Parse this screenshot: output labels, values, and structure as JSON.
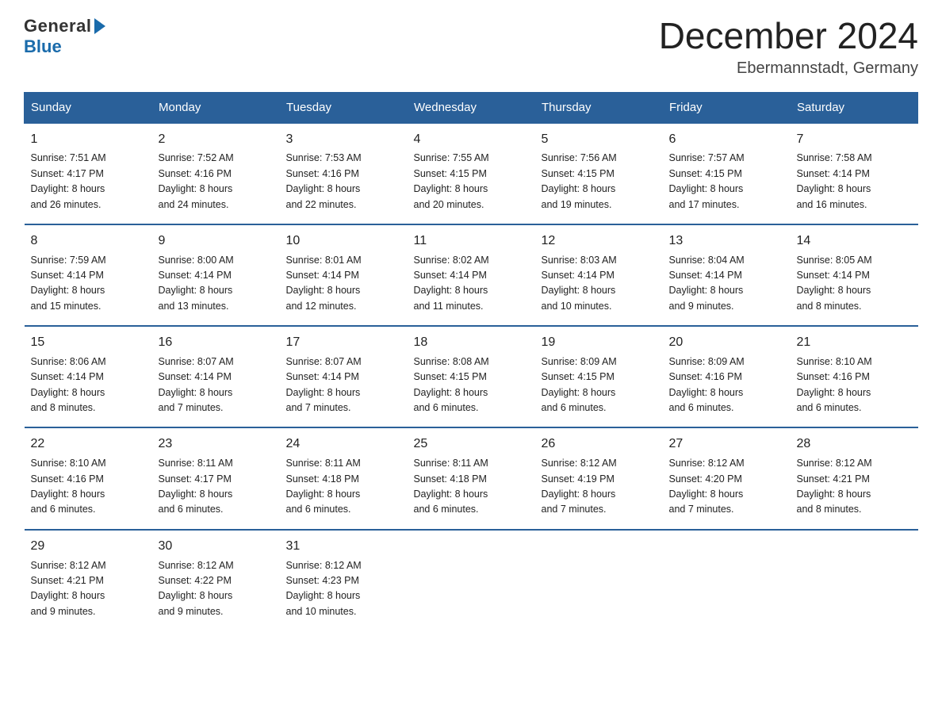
{
  "logo": {
    "general": "General",
    "blue": "Blue"
  },
  "title": {
    "month": "December 2024",
    "location": "Ebermannstadt, Germany"
  },
  "headers": [
    "Sunday",
    "Monday",
    "Tuesday",
    "Wednesday",
    "Thursday",
    "Friday",
    "Saturday"
  ],
  "weeks": [
    [
      {
        "day": "1",
        "info": "Sunrise: 7:51 AM\nSunset: 4:17 PM\nDaylight: 8 hours\nand 26 minutes."
      },
      {
        "day": "2",
        "info": "Sunrise: 7:52 AM\nSunset: 4:16 PM\nDaylight: 8 hours\nand 24 minutes."
      },
      {
        "day": "3",
        "info": "Sunrise: 7:53 AM\nSunset: 4:16 PM\nDaylight: 8 hours\nand 22 minutes."
      },
      {
        "day": "4",
        "info": "Sunrise: 7:55 AM\nSunset: 4:15 PM\nDaylight: 8 hours\nand 20 minutes."
      },
      {
        "day": "5",
        "info": "Sunrise: 7:56 AM\nSunset: 4:15 PM\nDaylight: 8 hours\nand 19 minutes."
      },
      {
        "day": "6",
        "info": "Sunrise: 7:57 AM\nSunset: 4:15 PM\nDaylight: 8 hours\nand 17 minutes."
      },
      {
        "day": "7",
        "info": "Sunrise: 7:58 AM\nSunset: 4:14 PM\nDaylight: 8 hours\nand 16 minutes."
      }
    ],
    [
      {
        "day": "8",
        "info": "Sunrise: 7:59 AM\nSunset: 4:14 PM\nDaylight: 8 hours\nand 15 minutes."
      },
      {
        "day": "9",
        "info": "Sunrise: 8:00 AM\nSunset: 4:14 PM\nDaylight: 8 hours\nand 13 minutes."
      },
      {
        "day": "10",
        "info": "Sunrise: 8:01 AM\nSunset: 4:14 PM\nDaylight: 8 hours\nand 12 minutes."
      },
      {
        "day": "11",
        "info": "Sunrise: 8:02 AM\nSunset: 4:14 PM\nDaylight: 8 hours\nand 11 minutes."
      },
      {
        "day": "12",
        "info": "Sunrise: 8:03 AM\nSunset: 4:14 PM\nDaylight: 8 hours\nand 10 minutes."
      },
      {
        "day": "13",
        "info": "Sunrise: 8:04 AM\nSunset: 4:14 PM\nDaylight: 8 hours\nand 9 minutes."
      },
      {
        "day": "14",
        "info": "Sunrise: 8:05 AM\nSunset: 4:14 PM\nDaylight: 8 hours\nand 8 minutes."
      }
    ],
    [
      {
        "day": "15",
        "info": "Sunrise: 8:06 AM\nSunset: 4:14 PM\nDaylight: 8 hours\nand 8 minutes."
      },
      {
        "day": "16",
        "info": "Sunrise: 8:07 AM\nSunset: 4:14 PM\nDaylight: 8 hours\nand 7 minutes."
      },
      {
        "day": "17",
        "info": "Sunrise: 8:07 AM\nSunset: 4:14 PM\nDaylight: 8 hours\nand 7 minutes."
      },
      {
        "day": "18",
        "info": "Sunrise: 8:08 AM\nSunset: 4:15 PM\nDaylight: 8 hours\nand 6 minutes."
      },
      {
        "day": "19",
        "info": "Sunrise: 8:09 AM\nSunset: 4:15 PM\nDaylight: 8 hours\nand 6 minutes."
      },
      {
        "day": "20",
        "info": "Sunrise: 8:09 AM\nSunset: 4:16 PM\nDaylight: 8 hours\nand 6 minutes."
      },
      {
        "day": "21",
        "info": "Sunrise: 8:10 AM\nSunset: 4:16 PM\nDaylight: 8 hours\nand 6 minutes."
      }
    ],
    [
      {
        "day": "22",
        "info": "Sunrise: 8:10 AM\nSunset: 4:16 PM\nDaylight: 8 hours\nand 6 minutes."
      },
      {
        "day": "23",
        "info": "Sunrise: 8:11 AM\nSunset: 4:17 PM\nDaylight: 8 hours\nand 6 minutes."
      },
      {
        "day": "24",
        "info": "Sunrise: 8:11 AM\nSunset: 4:18 PM\nDaylight: 8 hours\nand 6 minutes."
      },
      {
        "day": "25",
        "info": "Sunrise: 8:11 AM\nSunset: 4:18 PM\nDaylight: 8 hours\nand 6 minutes."
      },
      {
        "day": "26",
        "info": "Sunrise: 8:12 AM\nSunset: 4:19 PM\nDaylight: 8 hours\nand 7 minutes."
      },
      {
        "day": "27",
        "info": "Sunrise: 8:12 AM\nSunset: 4:20 PM\nDaylight: 8 hours\nand 7 minutes."
      },
      {
        "day": "28",
        "info": "Sunrise: 8:12 AM\nSunset: 4:21 PM\nDaylight: 8 hours\nand 8 minutes."
      }
    ],
    [
      {
        "day": "29",
        "info": "Sunrise: 8:12 AM\nSunset: 4:21 PM\nDaylight: 8 hours\nand 9 minutes."
      },
      {
        "day": "30",
        "info": "Sunrise: 8:12 AM\nSunset: 4:22 PM\nDaylight: 8 hours\nand 9 minutes."
      },
      {
        "day": "31",
        "info": "Sunrise: 8:12 AM\nSunset: 4:23 PM\nDaylight: 8 hours\nand 10 minutes."
      },
      {
        "day": "",
        "info": ""
      },
      {
        "day": "",
        "info": ""
      },
      {
        "day": "",
        "info": ""
      },
      {
        "day": "",
        "info": ""
      }
    ]
  ]
}
